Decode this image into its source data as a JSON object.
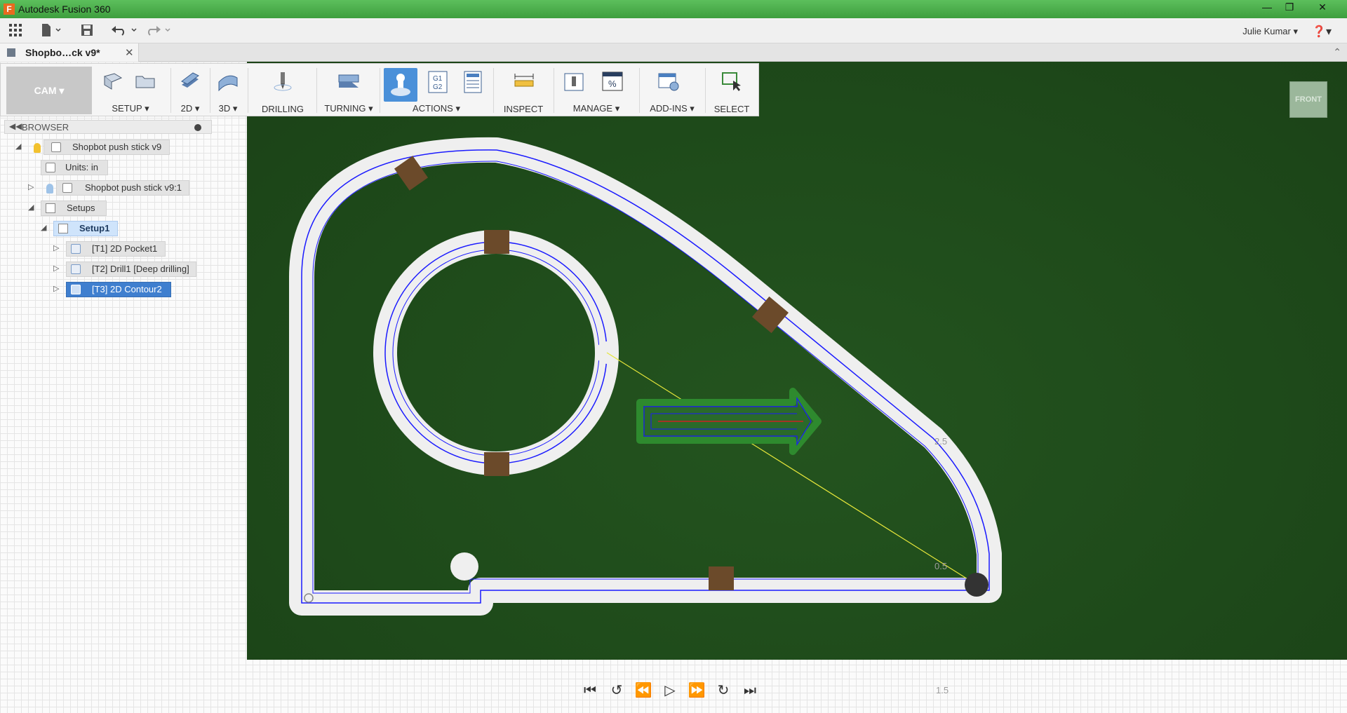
{
  "app": {
    "title": "Autodesk Fusion 360",
    "logo_letter": "F",
    "window_controls": [
      "minimize",
      "restore",
      "close"
    ]
  },
  "quick_access": {
    "user_name": "Julie Kumar",
    "icons": [
      "apps-grid-icon",
      "file-icon",
      "save-icon",
      "undo-icon",
      "redo-icon"
    ]
  },
  "document_tab": {
    "name": "Shopbo…ck v9*"
  },
  "ribbon": {
    "workspace": "CAM",
    "groups": {
      "setup": "SETUP",
      "g2d": "2D",
      "g3d": "3D",
      "drilling": "DRILLING",
      "turning": "TURNING",
      "actions": "ACTIONS",
      "inspect": "INSPECT",
      "manage": "MANAGE",
      "addins": "ADD-INS",
      "select": "SELECT"
    },
    "gcode_label_1": "G1",
    "gcode_label_2": "G2",
    "percent_label": "%"
  },
  "browser": {
    "title": "BROWSER",
    "items": [
      {
        "label": "Shopbot push stick v9"
      },
      {
        "label": "Units: in"
      },
      {
        "label": "Shopbot push stick v9:1"
      },
      {
        "label": "Setups"
      },
      {
        "label": "Setup1"
      },
      {
        "label": "[T1] 2D Pocket1"
      },
      {
        "label": "[T2] Drill1 [Deep drilling]"
      },
      {
        "label": "[T3] 2D Contour2"
      }
    ]
  },
  "viewport": {
    "viewcube_face": "FRONT",
    "axis_labels": [
      "2.5",
      "0.5",
      "1.5"
    ],
    "colors": {
      "stock": "#1f4a1b",
      "toolpath": "#1a1aff",
      "tab": "#6b4a2a",
      "selection": "#3f7fcf"
    }
  },
  "playback": {
    "buttons": [
      "first-icon",
      "prev-op-icon",
      "step-back-icon",
      "play-icon",
      "step-forward-icon",
      "next-op-icon",
      "last-icon"
    ]
  }
}
